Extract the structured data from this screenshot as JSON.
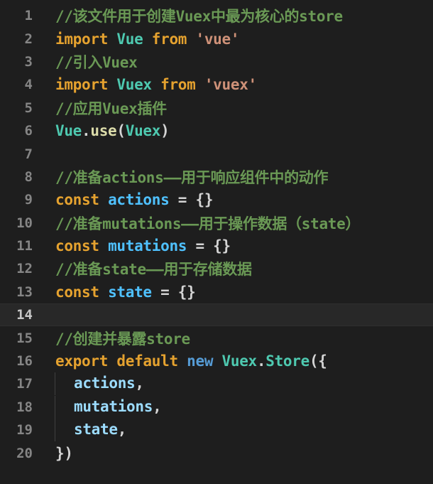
{
  "editor": {
    "lines": [
      {
        "n": "1",
        "tokens": [
          {
            "t": "cmt",
            "v": "//该文件用于创建Vuex中最为核心的store"
          }
        ]
      },
      {
        "n": "2",
        "tokens": [
          {
            "t": "kwo",
            "v": "import"
          },
          {
            "t": "pun",
            "v": " "
          },
          {
            "t": "cls",
            "v": "Vue"
          },
          {
            "t": "pun",
            "v": " "
          },
          {
            "t": "kwo",
            "v": "from"
          },
          {
            "t": "pun",
            "v": " "
          },
          {
            "t": "str",
            "v": "'vue'"
          }
        ]
      },
      {
        "n": "3",
        "tokens": [
          {
            "t": "cmt",
            "v": "//引入Vuex"
          }
        ]
      },
      {
        "n": "4",
        "tokens": [
          {
            "t": "kwo",
            "v": "import"
          },
          {
            "t": "pun",
            "v": " "
          },
          {
            "t": "cls",
            "v": "Vuex"
          },
          {
            "t": "pun",
            "v": " "
          },
          {
            "t": "kwo",
            "v": "from"
          },
          {
            "t": "pun",
            "v": " "
          },
          {
            "t": "str",
            "v": "'vuex'"
          }
        ]
      },
      {
        "n": "5",
        "tokens": [
          {
            "t": "cmt",
            "v": "//应用Vuex插件"
          }
        ]
      },
      {
        "n": "6",
        "tokens": [
          {
            "t": "cls",
            "v": "Vue"
          },
          {
            "t": "pun",
            "v": "."
          },
          {
            "t": "fn",
            "v": "use"
          },
          {
            "t": "pun",
            "v": "("
          },
          {
            "t": "cls",
            "v": "Vuex"
          },
          {
            "t": "pun",
            "v": ")"
          }
        ]
      },
      {
        "n": "7",
        "tokens": []
      },
      {
        "n": "8",
        "tokens": [
          {
            "t": "cmt",
            "v": "//准备actions——用于响应组件中的动作"
          }
        ]
      },
      {
        "n": "9",
        "tokens": [
          {
            "t": "kwo",
            "v": "const"
          },
          {
            "t": "pun",
            "v": " "
          },
          {
            "t": "varc",
            "v": "actions"
          },
          {
            "t": "pun",
            "v": " = {}"
          }
        ]
      },
      {
        "n": "10",
        "tokens": [
          {
            "t": "cmt",
            "v": "//准备mutations——用于操作数据（state）"
          }
        ]
      },
      {
        "n": "11",
        "tokens": [
          {
            "t": "kwo",
            "v": "const"
          },
          {
            "t": "pun",
            "v": " "
          },
          {
            "t": "varc",
            "v": "mutations"
          },
          {
            "t": "pun",
            "v": " = {}"
          }
        ]
      },
      {
        "n": "12",
        "tokens": [
          {
            "t": "cmt",
            "v": "//准备state——用于存储数据"
          }
        ]
      },
      {
        "n": "13",
        "tokens": [
          {
            "t": "kwo",
            "v": "const"
          },
          {
            "t": "pun",
            "v": " "
          },
          {
            "t": "varc",
            "v": "state"
          },
          {
            "t": "pun",
            "v": " = {}"
          }
        ]
      },
      {
        "n": "14",
        "tokens": [],
        "current": true
      },
      {
        "n": "15",
        "tokens": [
          {
            "t": "cmt",
            "v": "//创建并暴露store"
          }
        ]
      },
      {
        "n": "16",
        "tokens": [
          {
            "t": "kwo",
            "v": "export"
          },
          {
            "t": "pun",
            "v": " "
          },
          {
            "t": "kwo",
            "v": "default"
          },
          {
            "t": "pun",
            "v": " "
          },
          {
            "t": "kwb",
            "v": "new"
          },
          {
            "t": "pun",
            "v": " "
          },
          {
            "t": "cls",
            "v": "Vuex"
          },
          {
            "t": "pun",
            "v": "."
          },
          {
            "t": "cls",
            "v": "Store"
          },
          {
            "t": "pun",
            "v": "({"
          }
        ]
      },
      {
        "n": "17",
        "indent": true,
        "tokens": [
          {
            "t": "prop",
            "v": "actions"
          },
          {
            "t": "pun",
            "v": ","
          }
        ]
      },
      {
        "n": "18",
        "indent": true,
        "tokens": [
          {
            "t": "prop",
            "v": "mutations"
          },
          {
            "t": "pun",
            "v": ","
          }
        ]
      },
      {
        "n": "19",
        "indent": true,
        "tokens": [
          {
            "t": "prop",
            "v": "state"
          },
          {
            "t": "pun",
            "v": ","
          }
        ]
      },
      {
        "n": "20",
        "tokens": [
          {
            "t": "pun",
            "v": "})"
          }
        ]
      }
    ]
  },
  "colors": {
    "background": "#1e1e1e",
    "comment": "#6a9955",
    "keyword": "#e5a22f",
    "identifier": "#4fc1ff",
    "class": "#4ec9b0",
    "string": "#ce9178"
  }
}
